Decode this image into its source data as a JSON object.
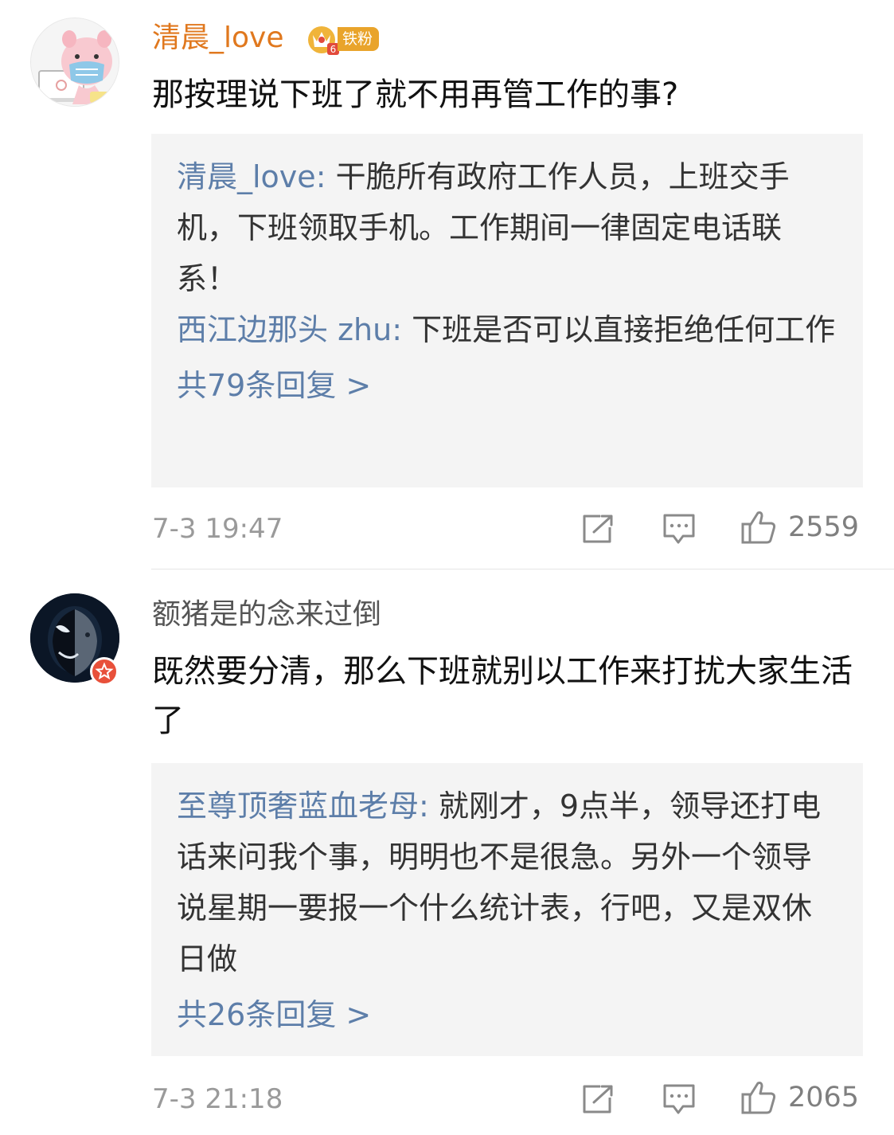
{
  "comments": [
    {
      "username": "清晨_love",
      "badge_label": "铁粉",
      "badge_level": "6",
      "text": "那按理说下班了就不用再管工作的事?",
      "replies": [
        {
          "name": "清晨_love",
          "sep": ": ",
          "text": "干脆所有政府工作人员，上班交手机，下班领取手机。工作期间一律固定电话联系！"
        },
        {
          "name": "西江边那头 zhu",
          "sep": ": ",
          "text": "下班是否可以直接拒绝任何工作"
        }
      ],
      "more_replies": "共79条回复 >",
      "time": "7-3 19:47",
      "likes": "2559",
      "icons": {
        "share": "share-icon",
        "comment": "comment-icon",
        "like": "thumbs-up-icon"
      }
    },
    {
      "username": "额猪是的念来过倒",
      "text": "既然要分清，那么下班就别以工作来打扰大家生活了",
      "replies": [
        {
          "name": "至尊顶奢蓝血老母",
          "sep": ": ",
          "text": "就刚才，9点半，领导还打电话来问我个事，明明也不是很急。另外一个领导说星期一要报一个什么统计表，行吧，又是双休日做"
        }
      ],
      "more_replies": "共26条回复 >",
      "time": "7-3 21:18",
      "likes": "2065",
      "icons": {
        "share": "share-icon",
        "comment": "comment-icon",
        "like": "thumbs-up-icon"
      }
    }
  ],
  "colors": {
    "username_orange": "#e0781e",
    "reply_name_blue": "#5d7ea9",
    "reply_bg": "#f4f4f4",
    "badge_gold": "#e9a42b",
    "verified_red": "#e8503a"
  }
}
